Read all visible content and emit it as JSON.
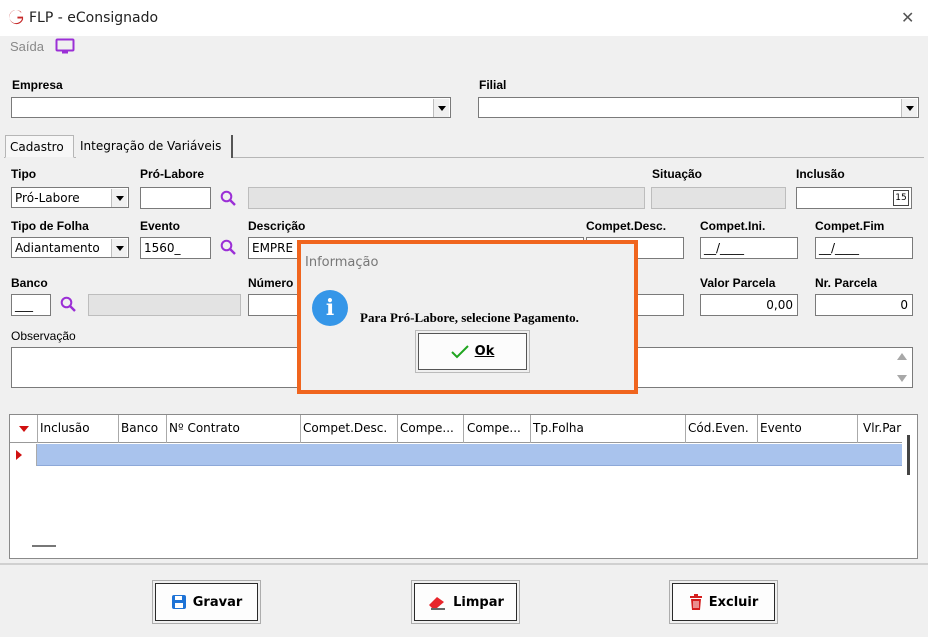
{
  "window": {
    "title": "FLP - eConsignado",
    "close_glyph": "✕"
  },
  "menu": {
    "saida_label": "Saída",
    "monitor_icon": "monitor-icon"
  },
  "empresa": {
    "label": "Empresa",
    "value": ""
  },
  "filial": {
    "label": "Filial",
    "value": ""
  },
  "tabs": [
    {
      "label": "Cadastro",
      "active": true
    },
    {
      "label": "Integração de Variáveis",
      "active": false
    }
  ],
  "form": {
    "tipo": {
      "label": "Tipo",
      "value": "Pró-Labore"
    },
    "pro_labore": {
      "label": "Pró-Labore",
      "value": ""
    },
    "situacao": {
      "label": "Situação",
      "value": ""
    },
    "inclusao": {
      "label": "Inclusão",
      "value": "",
      "calendar_glyph": "15"
    },
    "tipo_folha": {
      "label": "Tipo de Folha",
      "value": "Adiantamento"
    },
    "evento": {
      "label": "Evento",
      "value": "1560_"
    },
    "descricao": {
      "label": "Descrição",
      "value": "EMPRE"
    },
    "compet_desc": {
      "label": "Compet.Desc.",
      "value": ""
    },
    "compet_ini": {
      "label": "Compet.Ini.",
      "value": "__/____"
    },
    "compet_fim": {
      "label": "Compet.Fim",
      "value": "__/____"
    },
    "banco": {
      "label": "Banco",
      "value": "___"
    },
    "numero": {
      "label": "Número",
      "value": ""
    },
    "valor_parcela": {
      "label": "Valor Parcela",
      "value": "0,00"
    },
    "nr_parcela": {
      "label": "Nr. Parcela",
      "value": "0"
    },
    "observacao": {
      "label": "Observação",
      "value": ""
    }
  },
  "grid": {
    "columns": [
      "Inclusão",
      "Banco",
      "Nº Contrato",
      "Compet.Desc.",
      "Compe...",
      "Compe...",
      "Tp.Folha",
      "Cód.Even.",
      "Evento",
      "Vlr.Par"
    ]
  },
  "footer": {
    "gravar": "Gravar",
    "limpar": "Limpar",
    "excluir": "Excluir"
  },
  "dialog": {
    "title": "Informação",
    "icon": "info-icon",
    "message": "Para Pró-Labore, selecione Pagamento.",
    "ok_label": "Ok",
    "border_color": "#f0651e"
  },
  "colors": {
    "accent_purple": "#9b2fd6",
    "selection_row": "#a9c3ed",
    "info_blue": "#3596e8"
  }
}
